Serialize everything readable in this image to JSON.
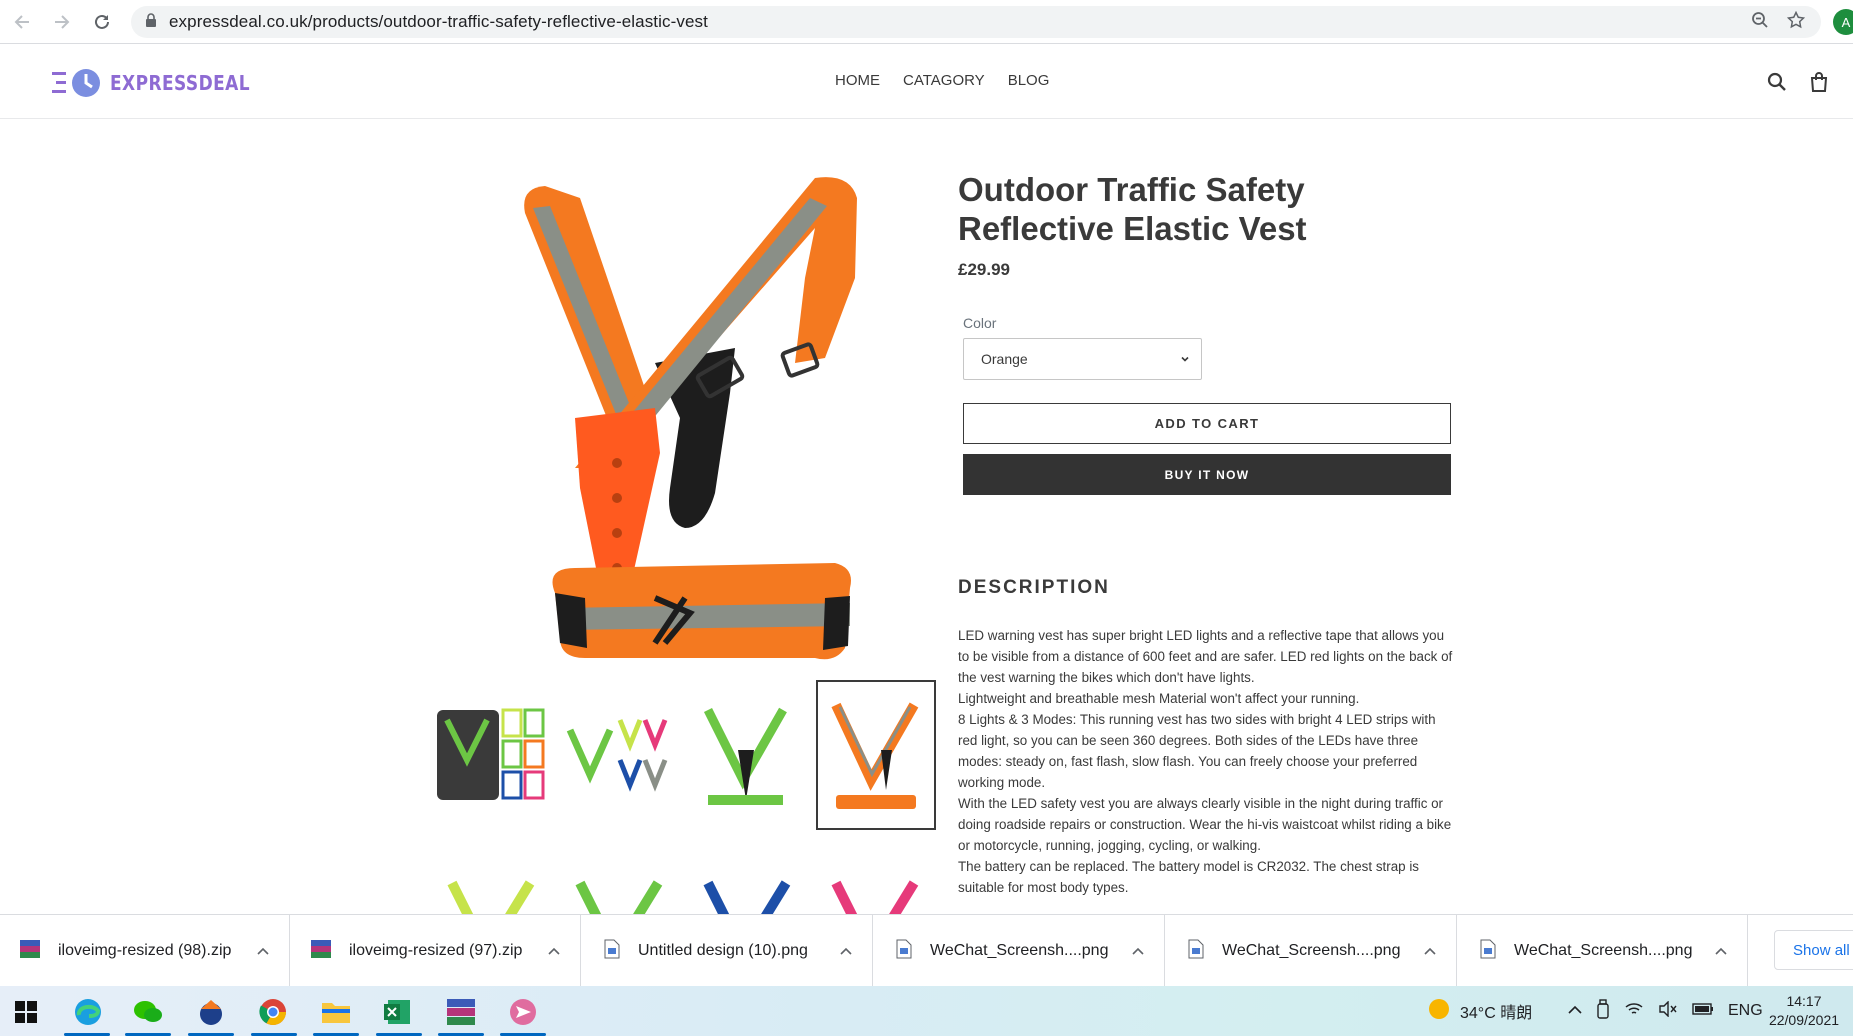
{
  "browser": {
    "url": "expressdeal.co.uk/products/outdoor-traffic-safety-reflective-elastic-vest",
    "profile_initial": "A"
  },
  "site": {
    "logo_text": "EXPRESSDEAL",
    "nav": [
      "HOME",
      "CATAGORY",
      "BLOG"
    ]
  },
  "product": {
    "title_line1": "Outdoor Traffic Safety",
    "title_line2": "Reflective Elastic Vest",
    "price": "£29.99",
    "color_label": "Color",
    "color_value": "Orange",
    "add_to_cart": "ADD TO CART",
    "buy_now": "BUY IT NOW",
    "description_heading": "DESCRIPTION",
    "description": [
      "LED warning vest has super bright LED lights and a reflective tape that allows you to be visible from a distance of 600 feet and are safer. LED red lights on the back of the vest warning the bikes which don't have lights.",
      "Lightweight and breathable mesh Material won't affect your running.",
      "8 Lights & 3 Modes: This running vest has two sides with bright 4 LED strips with red light, so you can be seen 360 degrees. Both sides of the LEDs have three modes: steady on, fast flash, slow flash. You can freely choose your preferred working mode.",
      "With the LED safety vest you are always clearly visible in the night during traffic or doing roadside repairs or construction. Wear the hi-vis waistcoat whilst riding a bike or motorcycle, running, jogging, cycling, or walking.",
      "The battery can be replaced. The battery model is CR2032. The chest strap is suitable for most body types."
    ],
    "colors": {
      "orange": "#f47920",
      "lime": "#c6e34a",
      "green": "#6cc644",
      "blue": "#1d4fa8",
      "pink": "#e63a7a",
      "reflective": "#8a8f87"
    }
  },
  "downloads": [
    {
      "name": "iloveimg-resized (98).zip",
      "icon": "winrar-icon"
    },
    {
      "name": "iloveimg-resized (97).zip",
      "icon": "winrar-icon"
    },
    {
      "name": "Untitled design (10).png",
      "icon": "image-file-icon"
    },
    {
      "name": "WeChat_Screensh....png",
      "icon": "image-file-icon"
    },
    {
      "name": "WeChat_Screensh....png",
      "icon": "image-file-icon"
    },
    {
      "name": "WeChat_Screensh....png",
      "icon": "image-file-icon"
    }
  ],
  "downloads_show_all": "Show all",
  "taskbar": {
    "weather": "34°C 晴朗",
    "language": "ENG",
    "time": "14:17",
    "date": "22/09/2021"
  }
}
